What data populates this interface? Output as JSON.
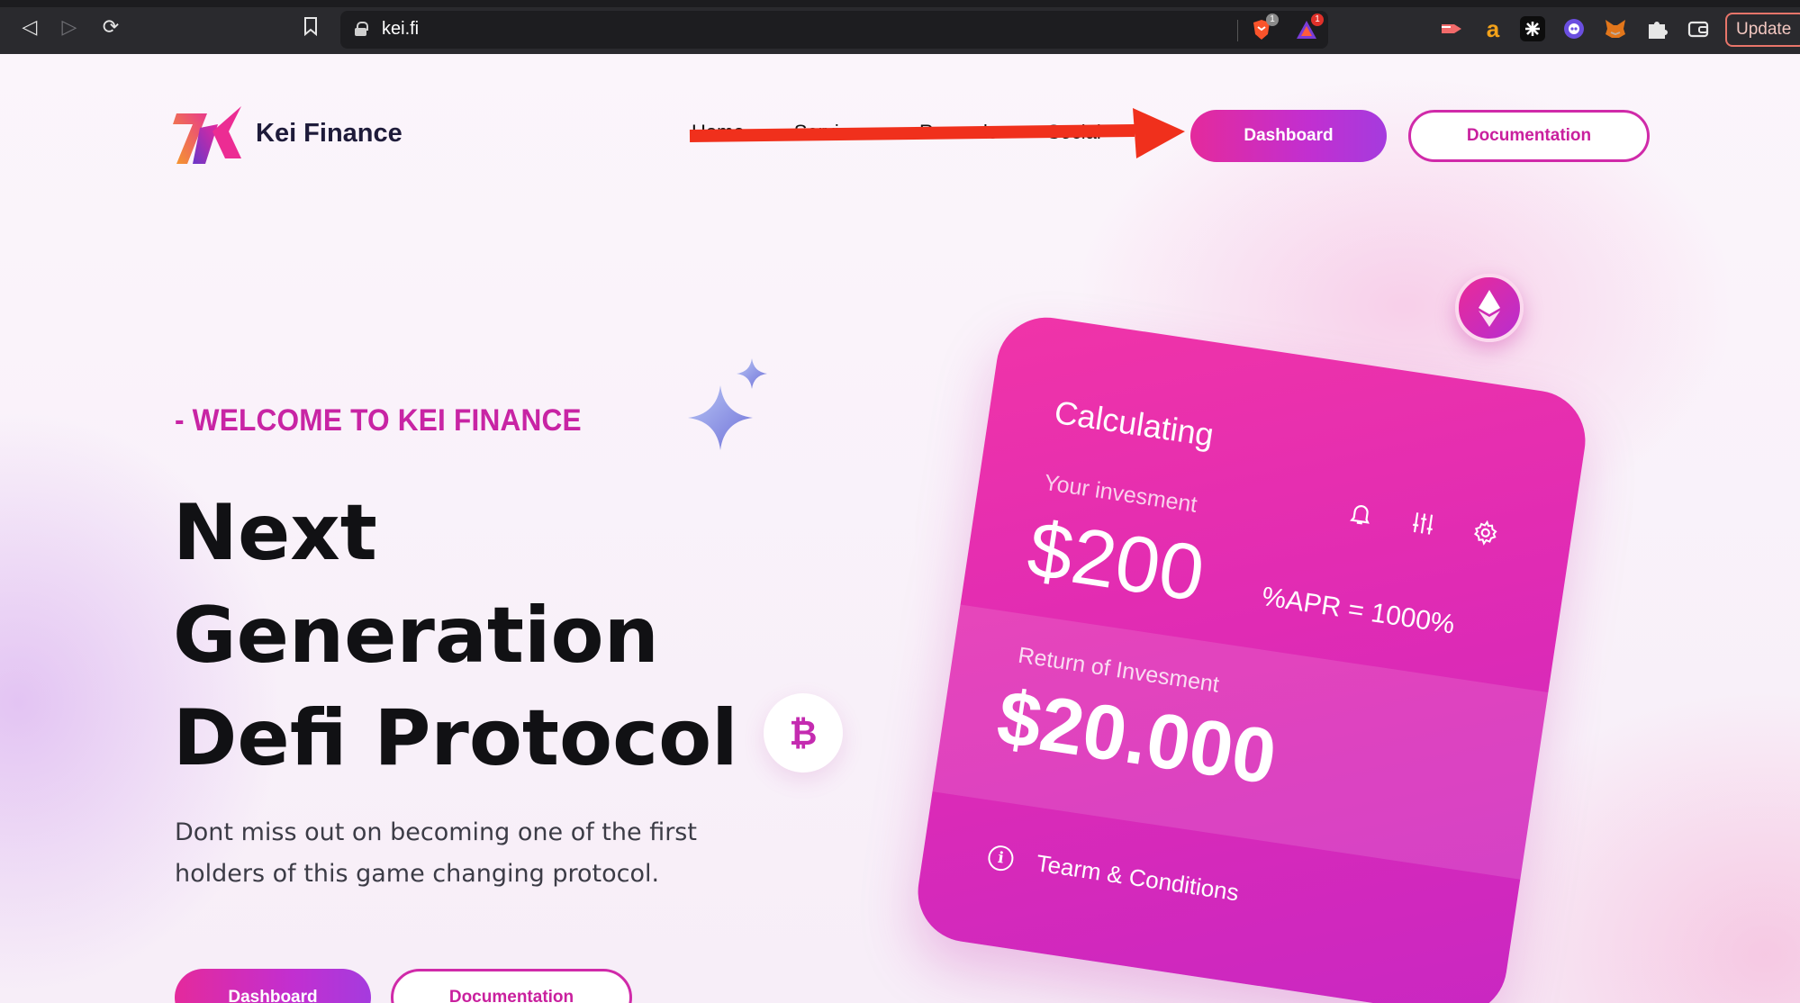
{
  "browser": {
    "url": "kei.fi",
    "brave_badge_count": "1",
    "rewards_badge_count": "1",
    "update_label": "Update",
    "extension_amazon_glyph": "a"
  },
  "header": {
    "brand": "Kei Finance",
    "nav": [
      "Home",
      "Services",
      "Rewards",
      "Social"
    ],
    "dashboard_label": "Dashboard",
    "documentation_label": "Documentation"
  },
  "hero": {
    "welcome": "- WELCOME TO KEI FINANCE",
    "headline": [
      "Next",
      "Generation",
      "Defi Protocol"
    ],
    "subtitle": "Dont miss out on becoming one of the first holders of this game changing protocol.",
    "dashboard_label": "Dashboard",
    "documentation_label": "Documentation"
  },
  "card": {
    "title": "Calculating",
    "investment_label": "Your invesment",
    "investment_amount": "$200",
    "apr": "%APR = 1000%",
    "return_label": "Return of Invesment",
    "return_amount": "$20.000",
    "terms": "Tearm & Conditions"
  },
  "coins": {
    "btc_glyph": "₿"
  },
  "colors": {
    "accent_pink": "#e42a9c",
    "accent_purple": "#a53bde",
    "annotation_arrow": "#f0301c"
  }
}
